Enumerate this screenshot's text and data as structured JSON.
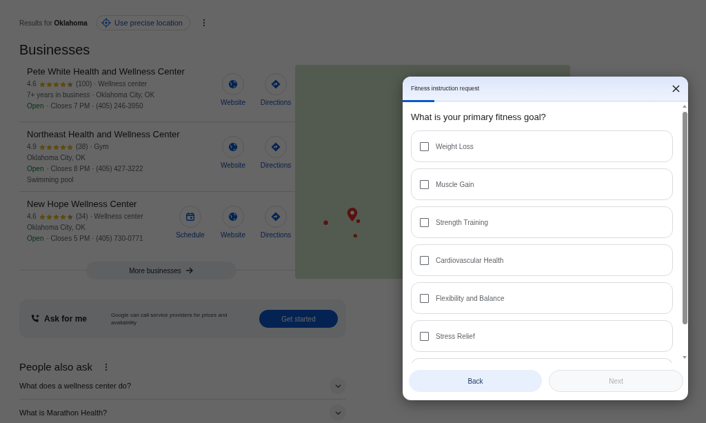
{
  "location_bar": {
    "prefix": "Results for",
    "place": "Oklahoma",
    "precise_button": "Use precise location"
  },
  "businesses": {
    "heading": "Businesses",
    "items": [
      {
        "name": "Pete White Health and Wellness Center",
        "rating": "4.6",
        "stars": 4.5,
        "reviews": "(100) · Wellness center",
        "lines": [
          "7+ years in business · Oklahoma City, OK"
        ],
        "open_status": "Open",
        "hours": "· Closes 7 PM · (405) 246-3950",
        "actions": [
          {
            "kind": "website",
            "label": "Website"
          },
          {
            "kind": "directions",
            "label": "Directions"
          }
        ]
      },
      {
        "name": "Northeast Health and Wellness Center",
        "rating": "4.9",
        "stars": 5,
        "reviews": "(38) · Gym",
        "lines": [
          "Oklahoma City, OK"
        ],
        "open_status": "Open",
        "hours": "· Closes 8 PM · (405) 427-3222",
        "extra": "Swimming pool",
        "actions": [
          {
            "kind": "website",
            "label": "Website"
          },
          {
            "kind": "directions",
            "label": "Directions"
          }
        ]
      },
      {
        "name": "New Hope Wellness Center",
        "rating": "4.6",
        "stars": 4.5,
        "reviews": "(34) · Wellness center",
        "lines": [
          "Oklahoma City, OK"
        ],
        "open_status": "Open",
        "hours": "· Closes 5 PM · (405) 730-0771",
        "actions": [
          {
            "kind": "schedule",
            "label": "Schedule"
          },
          {
            "kind": "website",
            "label": "Website"
          },
          {
            "kind": "directions",
            "label": "Directions"
          }
        ]
      }
    ],
    "more_button": "More businesses"
  },
  "ask_card": {
    "title": "Ask for me",
    "description": "Google can call service providers for prices and availability",
    "button": "Get started"
  },
  "people_also_ask": {
    "heading": "People also ask",
    "questions": [
      "What does a wellness center do?",
      "What is Marathon Health?"
    ]
  },
  "dialog": {
    "title": "Fitness instruction request",
    "progress": {
      "level": 0.11
    },
    "question": "What is your primary fitness goal?",
    "options": [
      {
        "label": "Weight Loss",
        "checked": false
      },
      {
        "label": "Muscle Gain",
        "checked": false
      },
      {
        "label": "Strength Training",
        "checked": false
      },
      {
        "label": "Cardiovascular Health",
        "checked": false
      },
      {
        "label": "Flexibility and Balance",
        "checked": false
      },
      {
        "label": "Stress Relief",
        "checked": false
      }
    ],
    "back_button": {
      "label": "Back",
      "disabled": false
    },
    "next_button": {
      "label": "Next",
      "disabled": true
    }
  }
}
